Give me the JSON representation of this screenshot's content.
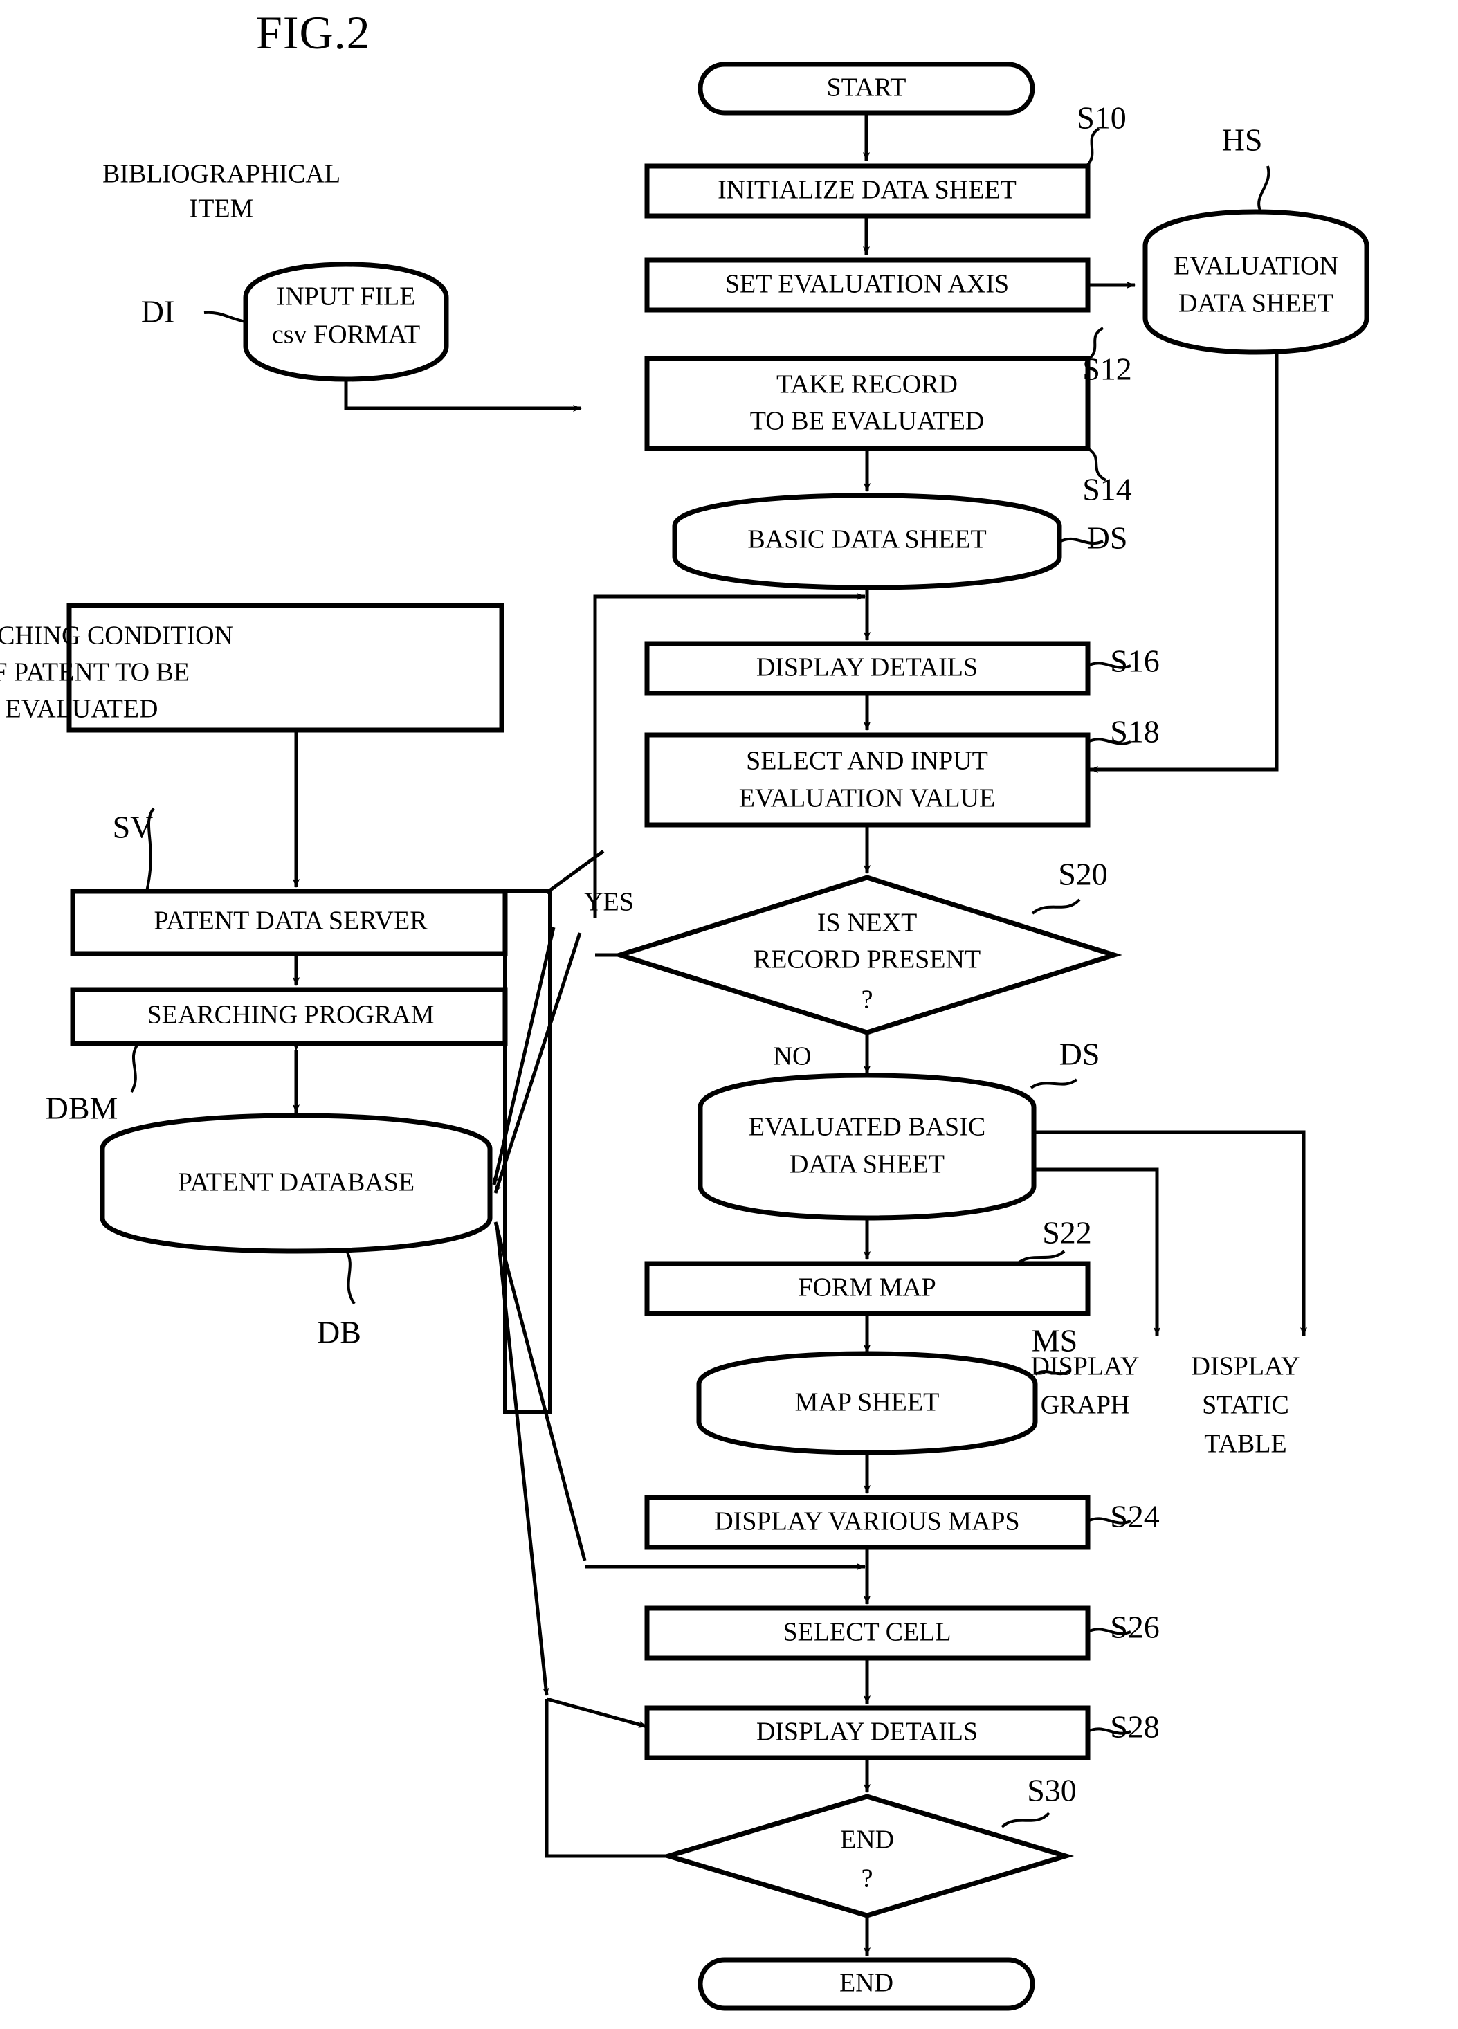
{
  "figure": {
    "title": "FIG.2",
    "type": "patent-flowchart"
  },
  "annotations": {
    "bibliographical_item_line1": "BIBLIOGRAPHICAL",
    "bibliographical_item_line2": "ITEM",
    "di": "DI",
    "hs": "HS",
    "ds_basic": "DS",
    "ds_evaluated": "DS",
    "ms": "MS",
    "sv": "SV",
    "dbm": "DBM",
    "db": "DB",
    "yes": "YES",
    "no": "NO",
    "display_graph_line1": "DISPLAY",
    "display_graph_line2": "GRAPH",
    "display_static_line1": "DISPLAY",
    "display_static_line2": "STATIC",
    "display_static_line3": "TABLE"
  },
  "step_refs": {
    "s10": "S10",
    "s12": "S12",
    "s14": "S14",
    "s16": "S16",
    "s18": "S18",
    "s20": "S20",
    "s22": "S22",
    "s24": "S24",
    "s26": "S26",
    "s28": "S28",
    "s30": "S30"
  },
  "nodes": {
    "start": {
      "label": "START",
      "shape": "terminator"
    },
    "initialize_data_sheet": {
      "label": "INITIALIZE DATA SHEET",
      "shape": "process"
    },
    "set_evaluation_axis": {
      "label": "SET EVALUATION AXIS",
      "shape": "process"
    },
    "take_record": {
      "line1": "TAKE RECORD",
      "line2": "TO BE EVALUATED",
      "shape": "process"
    },
    "basic_data_sheet": {
      "label": "BASIC DATA SHEET",
      "shape": "document"
    },
    "display_details_1": {
      "label": "DISPLAY DETAILS",
      "shape": "process"
    },
    "select_input_eval": {
      "line1": "SELECT AND INPUT",
      "line2": "EVALUATION VALUE",
      "shape": "process"
    },
    "is_next_record": {
      "line1": "IS NEXT",
      "line2": "RECORD PRESENT",
      "line3": "?",
      "shape": "decision"
    },
    "evaluated_basic_data_sheet": {
      "line1": "EVALUATED BASIC",
      "line2": "DATA SHEET",
      "shape": "document"
    },
    "form_map": {
      "label": "FORM MAP",
      "shape": "process"
    },
    "map_sheet": {
      "label": "MAP SHEET",
      "shape": "document"
    },
    "display_various_maps": {
      "label": "DISPLAY VARIOUS MAPS",
      "shape": "process"
    },
    "select_cell": {
      "label": "SELECT CELL",
      "shape": "process"
    },
    "display_details_2": {
      "label": "DISPLAY DETAILS",
      "shape": "process"
    },
    "end_decision": {
      "line1": "END",
      "line2": "?",
      "shape": "decision"
    },
    "end": {
      "label": "END",
      "shape": "terminator"
    },
    "input_file": {
      "line1": "INPUT FILE",
      "line2": "csv FORMAT",
      "shape": "document"
    },
    "evaluation_data_sheet": {
      "line1": "EVALUATION",
      "line2": "DATA SHEET",
      "shape": "document"
    },
    "searching_condition": {
      "line1": "SEARCHING CONDITION",
      "line2": "OF PATENT TO BE",
      "line3": "EVALUATED",
      "shape": "process"
    },
    "patent_data_server": {
      "label": "PATENT DATA SERVER",
      "shape": "process"
    },
    "searching_program": {
      "label": "SEARCHING PROGRAM",
      "shape": "process"
    },
    "patent_database": {
      "label": "PATENT DATABASE",
      "shape": "document"
    }
  },
  "colors": {
    "ink": "#000000",
    "paper": "#ffffff"
  }
}
